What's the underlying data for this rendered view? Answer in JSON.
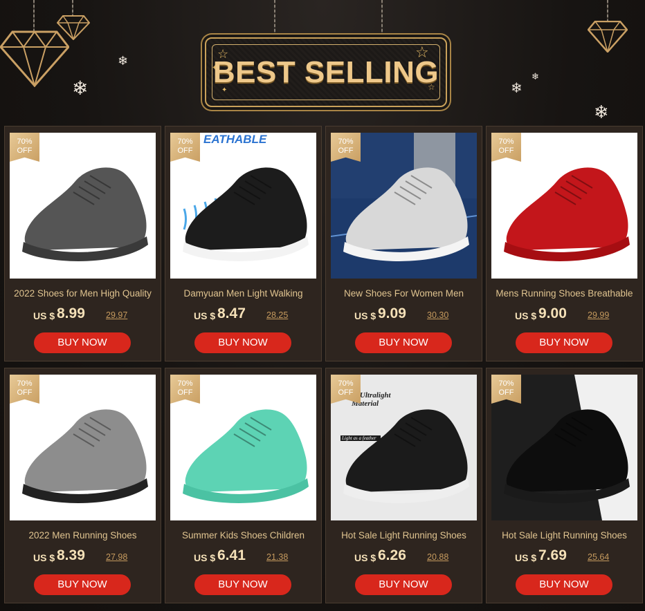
{
  "banner": {
    "title": "BEST SELLING"
  },
  "colors": {
    "accent_gold": "#e0c490",
    "buy_button": "#d8271c",
    "card_bg": "#2e251f",
    "page_bg": "#161311"
  },
  "products": [
    {
      "discount": "70%\nOFF",
      "title": "2022 Shoes for Men High Quality",
      "currency": "US $",
      "price": "8.99",
      "old_price": "29.97",
      "cta": "BUY NOW",
      "image_icon": "gray-running-shoe"
    },
    {
      "discount": "70%\nOFF",
      "title": "Damyuan Men Light Walking",
      "currency": "US $",
      "price": "8.47",
      "old_price": "28.25",
      "cta": "BUY NOW",
      "image_icon": "black-breathable-shoe",
      "image_text": "EATHABLE\nH"
    },
    {
      "discount": "70%\nOFF",
      "title": "New Shoes For Women Men",
      "currency": "US $",
      "price": "9.09",
      "old_price": "30.30",
      "cta": "BUY NOW",
      "image_icon": "white-green-shoe"
    },
    {
      "discount": "70%\nOFF",
      "title": "Mens Running Shoes Breathable",
      "currency": "US $",
      "price": "9.00",
      "old_price": "29.99",
      "cta": "BUY NOW",
      "image_icon": "red-running-shoe"
    },
    {
      "discount": "70%\nOFF",
      "title": "2022 Men Running Shoes",
      "currency": "US $",
      "price": "8.39",
      "old_price": "27.98",
      "cta": "BUY NOW",
      "image_icon": "black-white-gradient-shoe"
    },
    {
      "discount": "70%\nOFF",
      "title": "Summer Kids Shoes Children",
      "currency": "US $",
      "price": "6.41",
      "old_price": "21.38",
      "cta": "BUY NOW",
      "image_icon": "mint-kids-shoe"
    },
    {
      "discount": "70%\nOFF",
      "title": "Hot Sale Light Running Shoes",
      "currency": "US $",
      "price": "6.26",
      "old_price": "20.88",
      "cta": "BUY NOW",
      "image_icon": "black-ultralight-shoe",
      "image_text": "er Ultralight\nMaterial",
      "image_tag": "Light as a feather"
    },
    {
      "discount": "70%\nOFF",
      "title": "Hot Sale Light Running Shoes",
      "currency": "US $",
      "price": "7.69",
      "old_price": "25.64",
      "cta": "BUY NOW",
      "image_icon": "black-sock-shoe"
    }
  ]
}
